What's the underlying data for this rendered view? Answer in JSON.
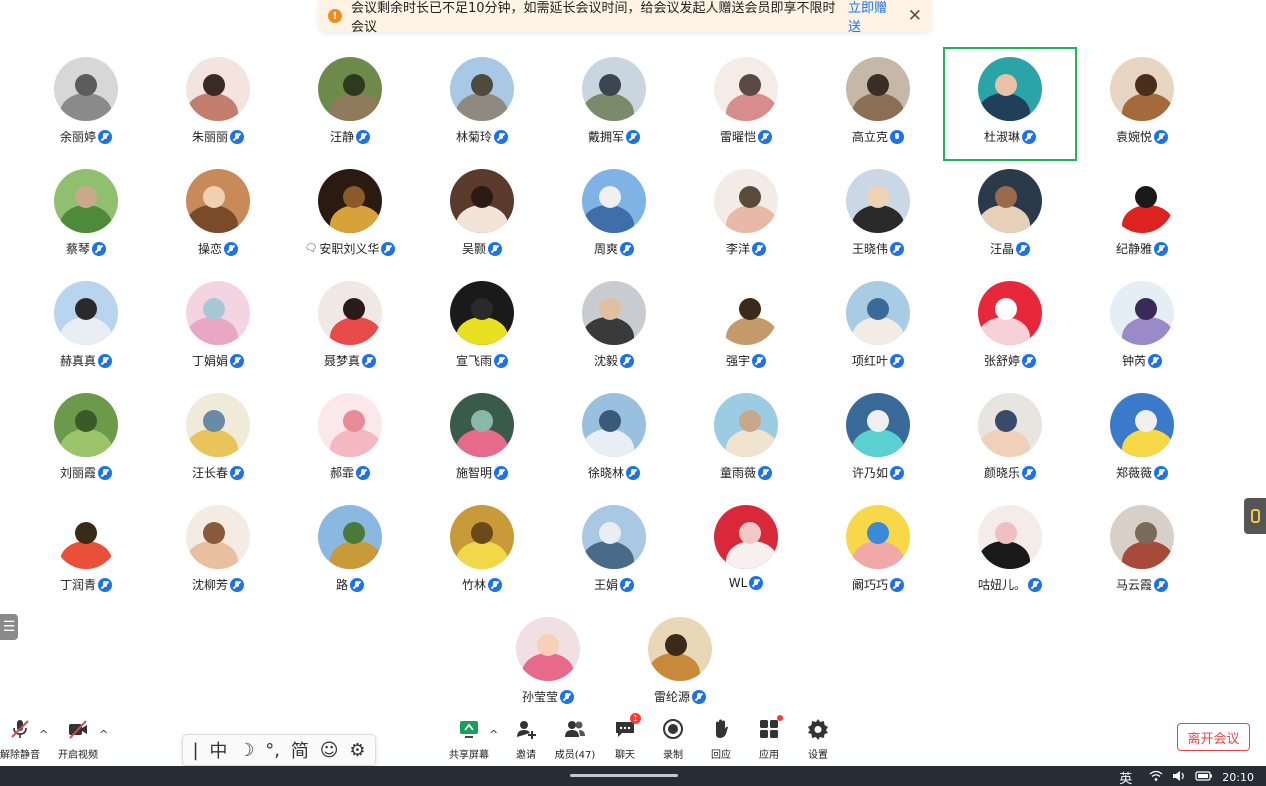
{
  "notice": {
    "text": "会议剩余时长已不足10分钟，如需延长会议时间，给会议发起人赠送会员即享不限时会议",
    "action": "立即赠送",
    "close_icon": "close-icon"
  },
  "participants": [
    {
      "name": "余丽婷",
      "mic": "muted",
      "palette": [
        "#d7d7d7",
        "#8a8a8a",
        "#5c5c5c"
      ]
    },
    {
      "name": "朱丽丽",
      "mic": "muted",
      "palette": [
        "#f3e4e0",
        "#c47e6e",
        "#3a2a26"
      ]
    },
    {
      "name": "汪静",
      "mic": "muted",
      "palette": [
        "#6d8a4a",
        "#8e7b5c",
        "#2e3a1f"
      ]
    },
    {
      "name": "林菊玲",
      "mic": "muted",
      "palette": [
        "#a9c8e6",
        "#8e8a7f",
        "#4e4a3e"
      ]
    },
    {
      "name": "戴拥军",
      "mic": "muted",
      "palette": [
        "#c9d6e0",
        "#7a8a6a",
        "#3b4651"
      ]
    },
    {
      "name": "雷曜恺",
      "mic": "muted",
      "palette": [
        "#f5ece8",
        "#d88d8d",
        "#5b4a44"
      ]
    },
    {
      "name": "高立克",
      "mic": "active",
      "palette": [
        "#c5b8a8",
        "#8a6f54",
        "#3a2f26"
      ]
    },
    {
      "name": "杜淑琳",
      "mic": "muted",
      "palette": [
        "#2ba4a8",
        "#1f3f5a",
        "#e7c2a8"
      ]
    },
    {
      "name": "袁婉悦",
      "mic": "muted",
      "palette": [
        "#e9d6c2",
        "#a46a3c",
        "#4a2e1c"
      ]
    },
    {
      "name": "蔡琴",
      "mic": "muted",
      "palette": [
        "#8fbf6f",
        "#4f8a3a",
        "#c9a98a"
      ]
    },
    {
      "name": "操恋",
      "mic": "muted",
      "palette": [
        "#c98a5a",
        "#7a4a2a",
        "#f0d0b0"
      ]
    },
    {
      "name": "安职刘义华",
      "mic": "muted",
      "chat": true,
      "palette": [
        "#2a1a10",
        "#d8a23a",
        "#8a5a2a"
      ]
    },
    {
      "name": "吴颢",
      "mic": "muted",
      "palette": [
        "#5a3a2a",
        "#f2e4d8",
        "#2a1a14"
      ]
    },
    {
      "name": "周爽",
      "mic": "muted",
      "palette": [
        "#7fb3e6",
        "#3e6fa8",
        "#f0f0f0"
      ]
    },
    {
      "name": "李洋",
      "mic": "muted",
      "palette": [
        "#f3ece6",
        "#e8b8a8",
        "#5a4a3a"
      ]
    },
    {
      "name": "王晓伟",
      "mic": "muted",
      "palette": [
        "#c9d8e4",
        "#2a2a2a",
        "#f0d2b4"
      ]
    },
    {
      "name": "汪晶",
      "mic": "muted",
      "palette": [
        "#2a3a4a",
        "#e8d0b8",
        "#9a6a4a"
      ]
    },
    {
      "name": "纪静雅",
      "mic": "muted",
      "palette": [
        "#ffffff",
        "#d22",
        "#1a1a1a"
      ]
    },
    {
      "name": "赫真真",
      "mic": "muted",
      "palette": [
        "#b8d4ee",
        "#e8eef4",
        "#2a2a2a"
      ]
    },
    {
      "name": "丁娟娟",
      "mic": "muted",
      "palette": [
        "#f4d4e0",
        "#e8a8c4",
        "#a8c8d8"
      ]
    },
    {
      "name": "聂梦真",
      "mic": "muted",
      "palette": [
        "#f0e8e4",
        "#e84a4a",
        "#2a1a1a"
      ]
    },
    {
      "name": "宣飞雨",
      "mic": "muted",
      "palette": [
        "#1a1a1a",
        "#e8e020",
        "#2a2a2a"
      ]
    },
    {
      "name": "沈毅",
      "mic": "muted",
      "palette": [
        "#c8ccd0",
        "#3a3a3a",
        "#e0c0a0"
      ]
    },
    {
      "name": "强宇",
      "mic": "muted",
      "palette": [
        "#ffffff",
        "#c49a6a",
        "#3a2a1a"
      ]
    },
    {
      "name": "项红叶",
      "mic": "muted",
      "palette": [
        "#a8cce4",
        "#f2ece4",
        "#3a6a9a"
      ]
    },
    {
      "name": "张舒婷",
      "mic": "muted",
      "palette": [
        "#e8283a",
        "#f8d0d8",
        "#ffffff"
      ]
    },
    {
      "name": "钟芮",
      "mic": "muted",
      "palette": [
        "#e4eef4",
        "#9a8ac8",
        "#3a2a5a"
      ]
    },
    {
      "name": "刘丽霞",
      "mic": "muted",
      "palette": [
        "#6a9a4a",
        "#9cc46a",
        "#3a5a2a"
      ]
    },
    {
      "name": "汪长春",
      "mic": "muted",
      "palette": [
        "#f0ead8",
        "#e8c45a",
        "#6a8aa8"
      ]
    },
    {
      "name": "郝霏",
      "mic": "muted",
      "palette": [
        "#fae8ea",
        "#f4b8c0",
        "#e88a98"
      ]
    },
    {
      "name": "施智明",
      "mic": "muted",
      "palette": [
        "#3a5a4a",
        "#e86a8a",
        "#8ab8a8"
      ]
    },
    {
      "name": "徐晓林",
      "mic": "muted",
      "palette": [
        "#9ac0e0",
        "#e8eef4",
        "#3a5a7a"
      ]
    },
    {
      "name": "童雨薇",
      "mic": "muted",
      "palette": [
        "#9ccce4",
        "#f0e4d0",
        "#c8a88a"
      ]
    },
    {
      "name": "许乃如",
      "mic": "muted",
      "palette": [
        "#3a6a9a",
        "#5ad0d0",
        "#f0f0f0"
      ]
    },
    {
      "name": "颜晓乐",
      "mic": "muted",
      "palette": [
        "#e8e4e0",
        "#f0d0b8",
        "#3a4a6a"
      ]
    },
    {
      "name": "郑薇薇",
      "mic": "muted",
      "palette": [
        "#3a7ac8",
        "#f8d848",
        "#f0f0f0"
      ]
    },
    {
      "name": "丁润青",
      "mic": "muted",
      "palette": [
        "#ffffff",
        "#e8503a",
        "#3a2a1a"
      ]
    },
    {
      "name": "沈柳芳",
      "mic": "muted",
      "palette": [
        "#f4ece4",
        "#e8c0a0",
        "#8a5a3a"
      ]
    },
    {
      "name": "路",
      "mic": "muted",
      "palette": [
        "#8ab8e0",
        "#c89a3a",
        "#4a7a3a"
      ]
    },
    {
      "name": "竹林",
      "mic": "muted",
      "palette": [
        "#c89a3a",
        "#f0d848",
        "#6a4a1a"
      ]
    },
    {
      "name": "王娟",
      "mic": "muted",
      "palette": [
        "#a8c8e4",
        "#4a6a8a",
        "#e8eef4"
      ]
    },
    {
      "name": "WL",
      "mic": "muted",
      "palette": [
        "#d8283a",
        "#f8f0f0",
        "#f0c8c8"
      ]
    },
    {
      "name": "阚巧巧",
      "mic": "muted",
      "palette": [
        "#f8d848",
        "#f0a8a8",
        "#3a8ad8"
      ]
    },
    {
      "name": "咕妞儿。",
      "mic": "muted",
      "palette": [
        "#f4ece8",
        "#1a1a1a",
        "#f0c0c0"
      ]
    },
    {
      "name": "马云霞",
      "mic": "muted",
      "palette": [
        "#d8d0c8",
        "#a84a3a",
        "#7a6a5a"
      ]
    },
    {
      "name": "孙莹莹",
      "mic": "muted",
      "palette": [
        "#f0e0e4",
        "#e86a8a",
        "#f8d0b8"
      ]
    },
    {
      "name": "雷纶源",
      "mic": "muted",
      "palette": [
        "#e8d8b8",
        "#c88a3a",
        "#3a2a1a"
      ]
    }
  ],
  "active_speaker": "杜淑琳",
  "toolbar": {
    "unmute": "解除静音",
    "start_video": "开启视频",
    "share_screen": "共享屏幕",
    "invite": "邀请",
    "members": "成员(47)",
    "chat": "聊天",
    "chat_badge": "1",
    "record": "录制",
    "reactions": "回应",
    "apps": "应用",
    "settings": "设置",
    "leave": "离开会议"
  },
  "ime": {
    "cursor": "|",
    "lang": "中",
    "mode": "☽",
    "punct": "°,",
    "charset": "简",
    "emoji": "☺",
    "settings": "⚙"
  },
  "taskbar": {
    "input_lang": "英",
    "time": "20:10",
    "icons": [
      "wifi-icon",
      "volume-icon",
      "battery-icon"
    ]
  },
  "colors": {
    "accent": "#1a73e8",
    "active_border": "#22b35b",
    "leave_red": "#e0484a",
    "notice_bg": "#fff3e5",
    "taskbar_bg": "#262d34"
  }
}
